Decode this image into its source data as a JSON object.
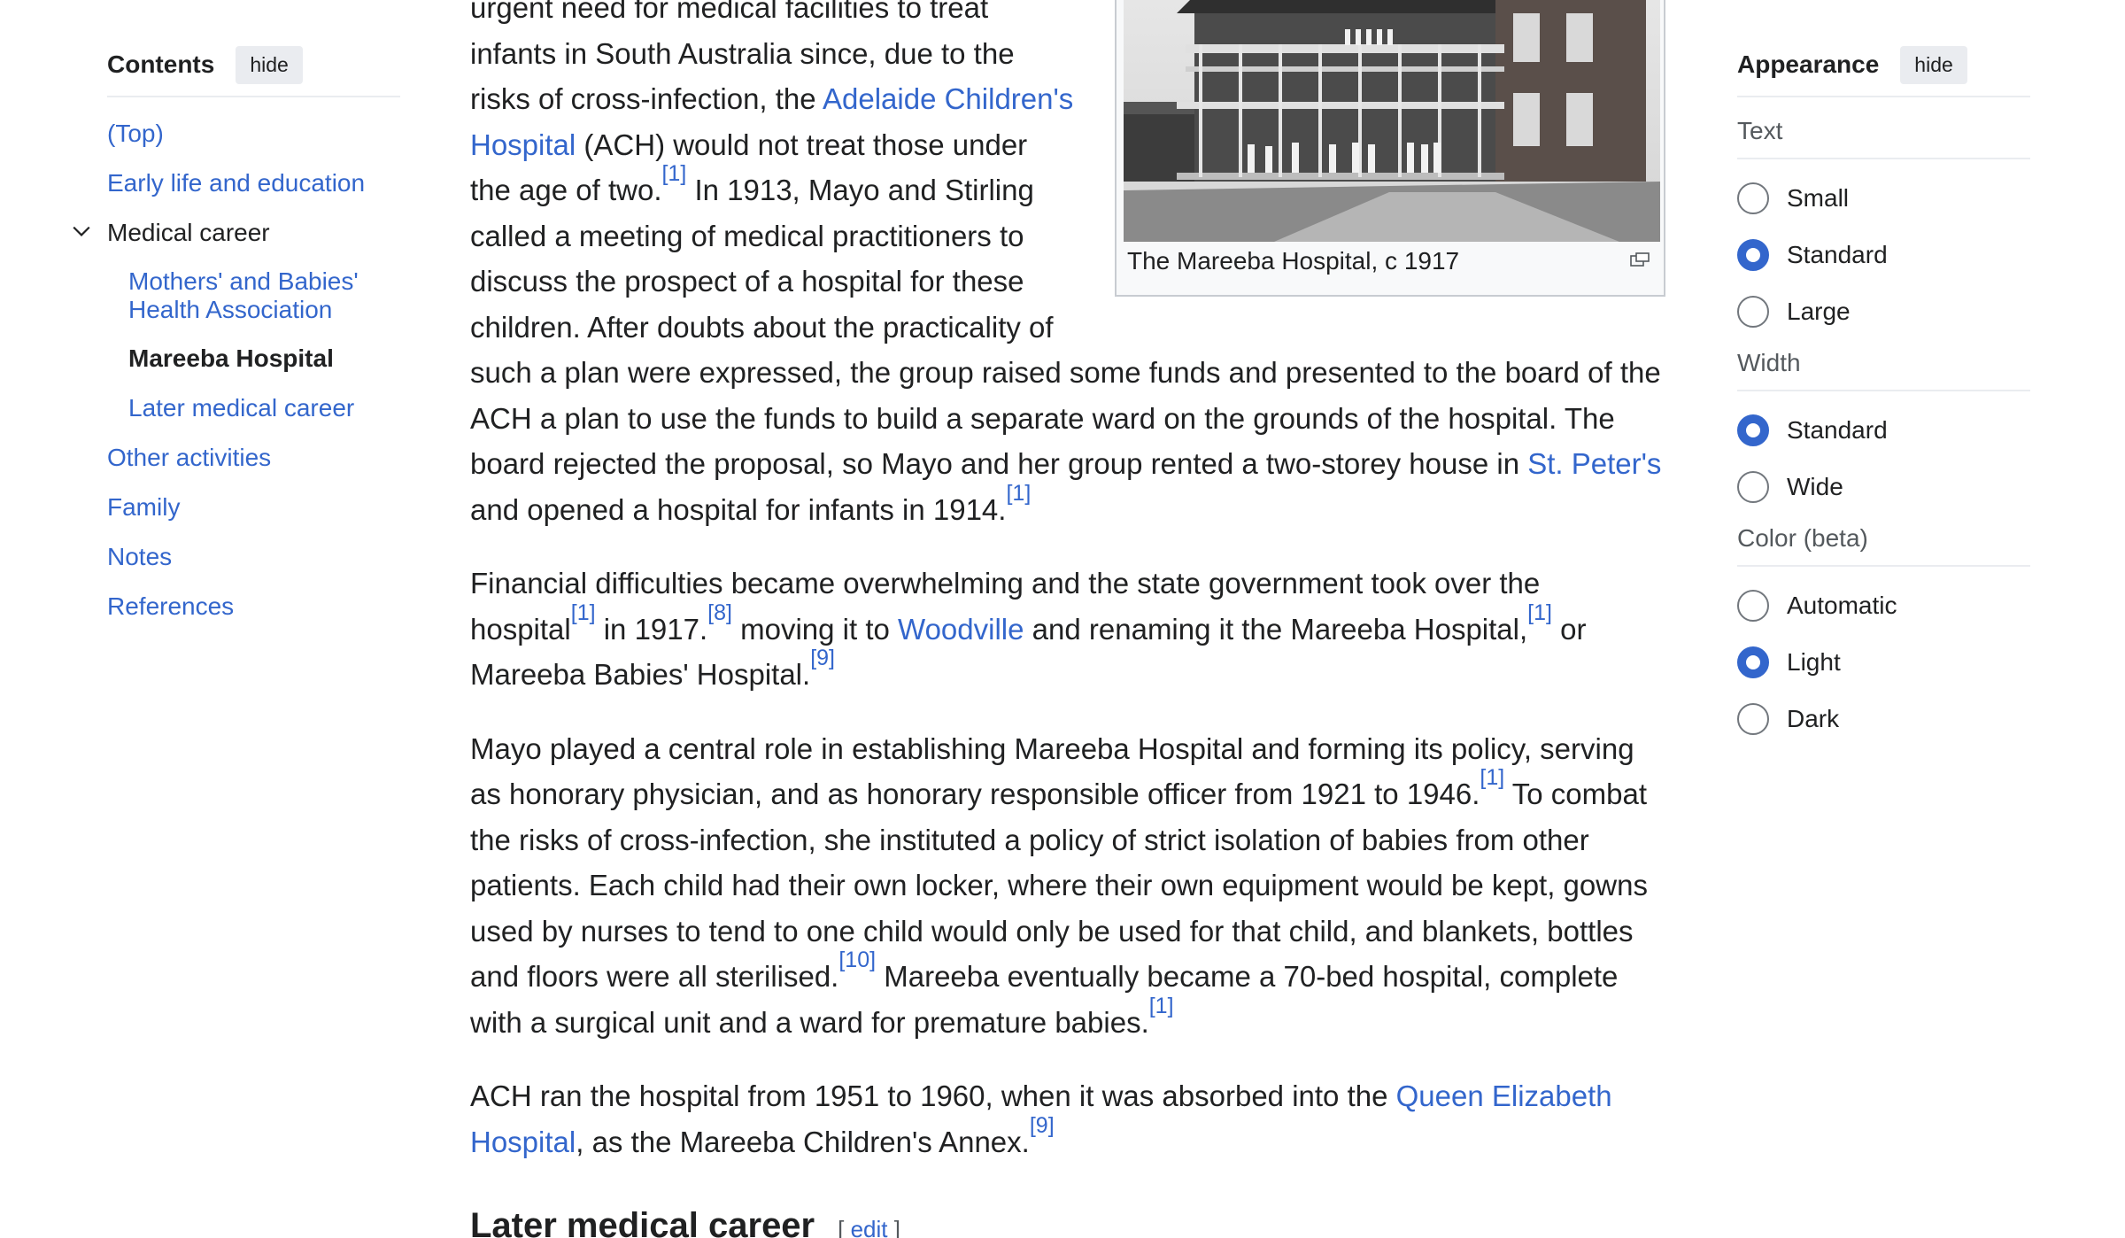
{
  "contents": {
    "title": "Contents",
    "hide_label": "hide",
    "items": [
      {
        "label": "(Top)"
      },
      {
        "label": "Early life and education"
      },
      {
        "label": "Medical career"
      },
      {
        "label": "Mothers' and Babies' Health Association"
      },
      {
        "label": "Mareeba Hospital"
      },
      {
        "label": "Later medical career"
      },
      {
        "label": "Other activities"
      },
      {
        "label": "Family"
      },
      {
        "label": "Notes"
      },
      {
        "label": "References"
      }
    ]
  },
  "figure": {
    "caption": "The Mareeba Hospital, c 1917"
  },
  "article": {
    "p1": {
      "t1": "urgent need for medical facilities to treat infants in South Australia since, due to the risks of cross-infection, the ",
      "link1": "Adelaide Children's Hospital",
      "t2": " (ACH) would not treat those under the age of two.",
      "ref1": "[1]",
      "t3": " In 1913, Mayo and Stirling called a meeting of medical practitioners to discuss the prospect of a hospital for these children. After doubts about the practicality of such a plan were expressed, the group raised some funds and presented to the board of the ACH a plan to use the funds to build a separate ward on the grounds of the hospital. The board rejected the proposal, so Mayo and her group rented a two-storey house in ",
      "link2": "St. Peter's",
      "t4": " and opened a hospital for infants in 1914.",
      "ref2": "[1]"
    },
    "p2": {
      "t1": "Financial difficulties became overwhelming and the state government took over the hospital",
      "ref1": "[1]",
      "t2": " in 1917.",
      "ref2": "[8]",
      "t3": " moving it to ",
      "link1": "Woodville",
      "t4": " and renaming it the Mareeba Hospital,",
      "ref3": "[1]",
      "t5": " or Mareeba Babies' Hospital.",
      "ref4": "[9]"
    },
    "p3": {
      "t1": "Mayo played a central role in establishing Mareeba Hospital and forming its policy, serving as honorary physician, and as honorary responsible officer from 1921 to 1946.",
      "ref1": "[1]",
      "t2": " To combat the risks of cross-infection, she instituted a policy of strict isolation of babies from other patients. Each child had their own locker, where their own equipment would be kept, gowns used by nurses to tend to one child would only be used for that child, and blankets, bottles and floors were all sterilised.",
      "ref2": "[10]",
      "t3": " Mareeba eventually became a 70-bed hospital, complete with a surgical unit and a ward for premature babies.",
      "ref3": "[1]"
    },
    "p4": {
      "t1": "ACH ran the hospital from 1951 to 1960, when it was absorbed into the ",
      "link1": "Queen Elizabeth Hospital",
      "t2": ", as the Mareeba Children's Annex.",
      "ref1": "[9]"
    },
    "section": {
      "title": "Later medical career",
      "bracket_open": "[",
      "edit_label": "edit",
      "bracket_close": "]"
    }
  },
  "appearance": {
    "title": "Appearance",
    "hide_label": "hide",
    "text": {
      "label": "Text",
      "options": [
        "Small",
        "Standard",
        "Large"
      ],
      "selected": "Standard"
    },
    "width": {
      "label": "Width",
      "options": [
        "Standard",
        "Wide"
      ],
      "selected": "Standard"
    },
    "color": {
      "label": "Color (beta)",
      "options": [
        "Automatic",
        "Light",
        "Dark"
      ],
      "selected": "Light"
    }
  },
  "colors": {
    "link": "#3366cc",
    "text": "#202122",
    "radio_checked": "#3366cc"
  }
}
